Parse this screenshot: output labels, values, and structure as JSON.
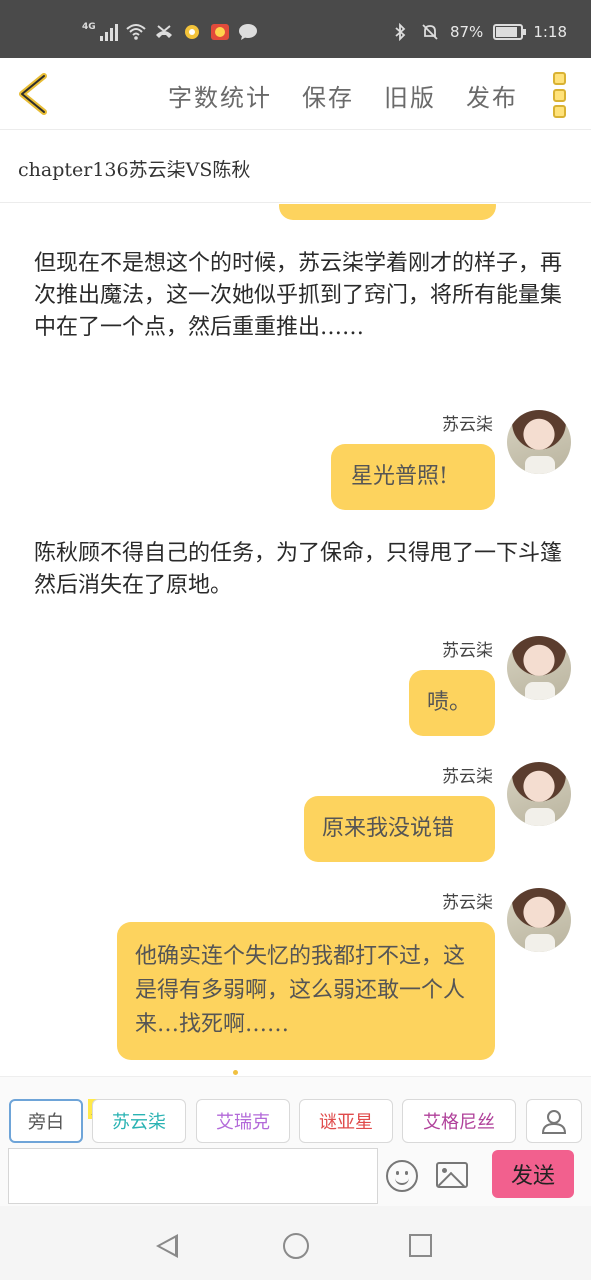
{
  "status_bar": {
    "network": "4G",
    "battery_text": "87%",
    "battery_level": 0.87,
    "time": "1:18",
    "icons": [
      "signal-icon",
      "wifi-icon",
      "missed-call-icon",
      "notification-icon",
      "app-icon",
      "chat-icon",
      "bluetooth-icon",
      "mute-bell-icon",
      "battery-icon"
    ]
  },
  "toolbar": {
    "back_icon": "chevron-left-icon",
    "actions": [
      "字数统计",
      "保存",
      "旧版",
      "发布"
    ],
    "more_icon": "more-vertical-icon"
  },
  "chapter_title": "chapter136苏云柒VS陈秋",
  "messages": [
    {
      "type": "narration",
      "text": "但现在不是想这个的时候，苏云柒学着刚才的样子，再次推出魔法，这一次她似乎抓到了窍门，将所有能量集中在了一个点，然后重重推出……"
    },
    {
      "type": "dialogue",
      "speaker": "苏云柒",
      "text": "星光普照!"
    },
    {
      "type": "narration",
      "text": "陈秋顾不得自己的任务，为了保命，只得甩了一下斗篷然后消失在了原地。"
    },
    {
      "type": "dialogue",
      "speaker": "苏云柒",
      "text": "啧。"
    },
    {
      "type": "dialogue",
      "speaker": "苏云柒",
      "text": "原来我没说错"
    },
    {
      "type": "dialogue",
      "speaker": "苏云柒",
      "text": "他确实连个失忆的我都打不过，这是得有多弱啊，这么弱还敢一个人来…找死啊……"
    }
  ],
  "characters": {
    "main_badge": "主",
    "chips": [
      {
        "label": "旁白",
        "color": "#555555"
      },
      {
        "label": "苏云柒",
        "color": "#2ab3b3"
      },
      {
        "label": "艾瑞克",
        "color": "#b36ad9"
      },
      {
        "label": "谜亚星",
        "color": "#e04b4b"
      },
      {
        "label": "艾格尼丝",
        "color": "#b0409a"
      }
    ],
    "add_icon": "person-icon"
  },
  "input": {
    "placeholder": "",
    "emoji_icon": "emoji-icon",
    "image_icon": "image-icon",
    "send_label": "发送"
  },
  "nav": {
    "icons": [
      "back-triangle-icon",
      "home-circle-icon",
      "recent-square-icon"
    ]
  }
}
